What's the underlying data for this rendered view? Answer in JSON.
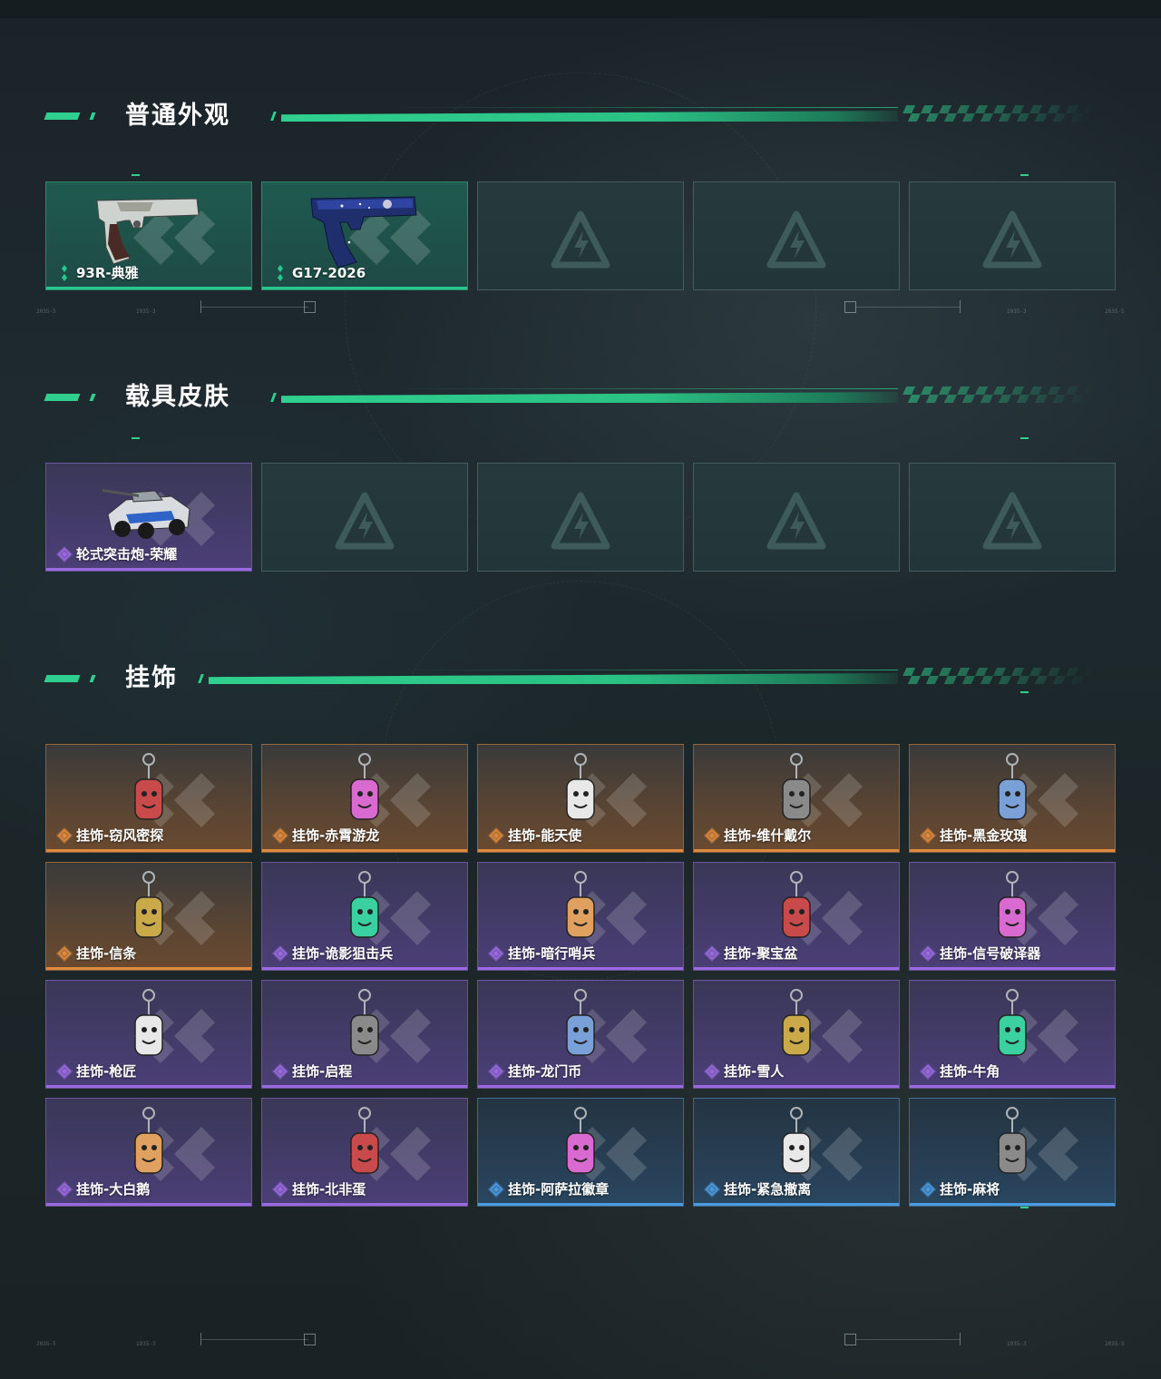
{
  "sections": [
    {
      "title": "普通外观",
      "items": [
        {
          "label": "93R-典雅",
          "rarity": "green",
          "icon": "pistol-93r-icon"
        },
        {
          "label": "G17-2026",
          "rarity": "green",
          "icon": "pistol-g17-icon"
        },
        {
          "label": "",
          "rarity": "empty"
        },
        {
          "label": "",
          "rarity": "empty"
        },
        {
          "label": "",
          "rarity": "empty"
        }
      ]
    },
    {
      "title": "载具皮肤",
      "items": [
        {
          "label": "轮式突击炮-荣耀",
          "rarity": "purple",
          "icon": "armored-vehicle-icon"
        },
        {
          "label": "",
          "rarity": "empty"
        },
        {
          "label": "",
          "rarity": "empty"
        },
        {
          "label": "",
          "rarity": "empty"
        },
        {
          "label": "",
          "rarity": "empty"
        }
      ]
    },
    {
      "title": "挂饰",
      "items": [
        {
          "label": "挂饰-窃风密探",
          "rarity": "orange",
          "icon": "charm-icon"
        },
        {
          "label": "挂饰-赤霄游龙",
          "rarity": "orange",
          "icon": "charm-icon"
        },
        {
          "label": "挂饰-能天使",
          "rarity": "orange",
          "icon": "charm-icon"
        },
        {
          "label": "挂饰-维什戴尔",
          "rarity": "orange",
          "icon": "charm-icon"
        },
        {
          "label": "挂饰-黑金玫瑰",
          "rarity": "orange",
          "icon": "charm-icon"
        },
        {
          "label": "挂饰-信条",
          "rarity": "orange",
          "icon": "charm-icon"
        },
        {
          "label": "挂饰-诡影狙击兵",
          "rarity": "purple",
          "icon": "charm-icon"
        },
        {
          "label": "挂饰-暗行哨兵",
          "rarity": "purple",
          "icon": "charm-icon"
        },
        {
          "label": "挂饰-聚宝盆",
          "rarity": "purple",
          "icon": "charm-icon"
        },
        {
          "label": "挂饰-信号破译器",
          "rarity": "purple",
          "icon": "charm-icon"
        },
        {
          "label": "挂饰-枪匠",
          "rarity": "purple",
          "icon": "charm-icon"
        },
        {
          "label": "挂饰-启程",
          "rarity": "purple",
          "icon": "charm-icon"
        },
        {
          "label": "挂饰-龙门币",
          "rarity": "purple",
          "icon": "charm-icon"
        },
        {
          "label": "挂饰-雪人",
          "rarity": "purple",
          "icon": "charm-icon"
        },
        {
          "label": "挂饰-牛角",
          "rarity": "purple",
          "icon": "charm-icon"
        },
        {
          "label": "挂饰-大白鹅",
          "rarity": "purple",
          "icon": "charm-icon"
        },
        {
          "label": "挂饰-北非蛋",
          "rarity": "purple",
          "icon": "charm-icon"
        },
        {
          "label": "挂饰-阿萨拉徽章",
          "rarity": "blue",
          "icon": "charm-icon"
        },
        {
          "label": "挂饰-紧急撤离",
          "rarity": "blue",
          "icon": "charm-icon"
        },
        {
          "label": "挂饰-麻将",
          "rarity": "blue",
          "icon": "charm-icon"
        }
      ]
    }
  ],
  "hud_text": {
    "left_a": "2035-5",
    "left_b": "1935-3",
    "right_a": "1935-3",
    "right_b": "2035-5"
  },
  "colors": {
    "accent": "#2fd08f",
    "rarity_green": "#29c790",
    "rarity_purple": "#9b6ae0",
    "rarity_orange": "#e08a3e",
    "rarity_blue": "#4b9be0"
  }
}
